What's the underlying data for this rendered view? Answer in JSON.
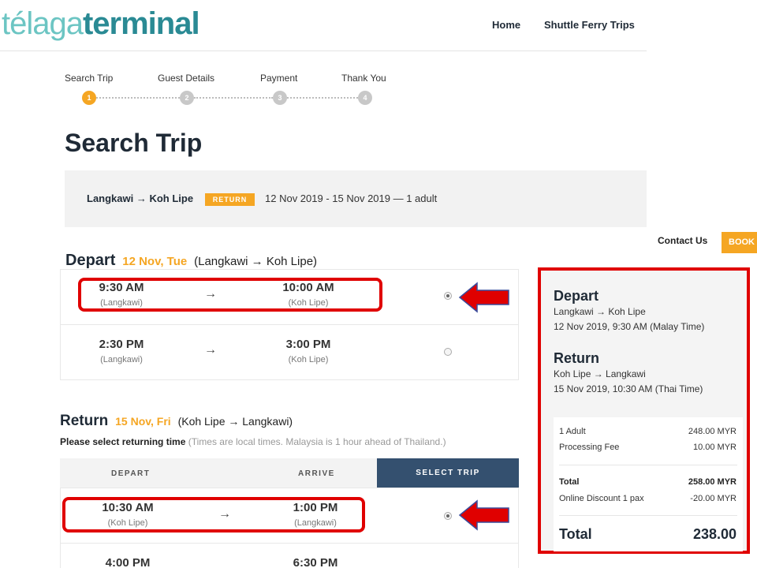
{
  "brand": {
    "logo_part1": "télaga",
    "logo_part2": "terminal"
  },
  "nav": {
    "home": "Home",
    "trips": "Shuttle Ferry Trips",
    "contact": "Contact Us",
    "book": "BOOK T"
  },
  "steps": [
    {
      "label": "Search Trip",
      "num": "1"
    },
    {
      "label": "Guest Details",
      "num": "2"
    },
    {
      "label": "Payment",
      "num": "3"
    },
    {
      "label": "Thank You",
      "num": "4"
    }
  ],
  "page_title": "Search Trip",
  "summary": {
    "route": "Langkawi → Koh Lipe",
    "badge": "RETURN",
    "dates": "12 Nov 2019 - 15 Nov 2019 — 1 adult"
  },
  "depart": {
    "title": "Depart",
    "date": "12 Nov, Tue",
    "route": "(Langkawi → Koh Lipe)",
    "trips": [
      {
        "dep_time": "9:30 AM",
        "dep_place": "(Langkawi)",
        "arr_time": "10:00 AM",
        "arr_place": "(Koh Lipe)",
        "arrow": "→",
        "selected": true
      },
      {
        "dep_time": "2:30 PM",
        "dep_place": "(Langkawi)",
        "arr_time": "3:00 PM",
        "arr_place": "(Koh Lipe)",
        "arrow": "→",
        "selected": false
      }
    ]
  },
  "return": {
    "title": "Return",
    "date": "15 Nov, Fri",
    "route": "(Koh Lipe → Langkawi)",
    "note_bold": "Please select returning time",
    "note": "(Times are local times. Malaysia is 1 hour ahead of Thailand.)",
    "headers": {
      "depart": "DEPART",
      "arrive": "ARRIVE",
      "select": "SELECT TRIP"
    },
    "trips": [
      {
        "dep_time": "10:30 AM",
        "dep_place": "(Koh Lipe)",
        "arr_time": "1:00 PM",
        "arr_place": "(Langkawi)",
        "arrow": "→",
        "selected": true
      },
      {
        "dep_time": "4:00 PM",
        "arr_time": "6:30 PM"
      }
    ]
  },
  "panel": {
    "depart_title": "Depart",
    "depart_route": "Langkawi → Koh Lipe",
    "depart_time": "12 Nov 2019, 9:30 AM (Malay Time)",
    "return_title": "Return",
    "return_route": "Koh Lipe → Langkawi",
    "return_time": "15 Nov 2019, 10:30 AM (Thai Time)",
    "rows": [
      {
        "label": "1 Adult",
        "value": "248.00 MYR"
      },
      {
        "label": "Processing Fee",
        "value": "10.00 MYR"
      }
    ],
    "subtotal_label": "Total",
    "subtotal_value": "258.00 MYR",
    "discount_label": "Online Discount 1 pax",
    "discount_value": "-20.00 MYR",
    "total_label": "Total",
    "total_value": "238.00"
  },
  "colors": {
    "accent": "#f5a623",
    "navy": "#34506f",
    "highlight": "#e00000",
    "logo_light": "#6cc5c3",
    "logo_dark": "#2a8a94"
  }
}
